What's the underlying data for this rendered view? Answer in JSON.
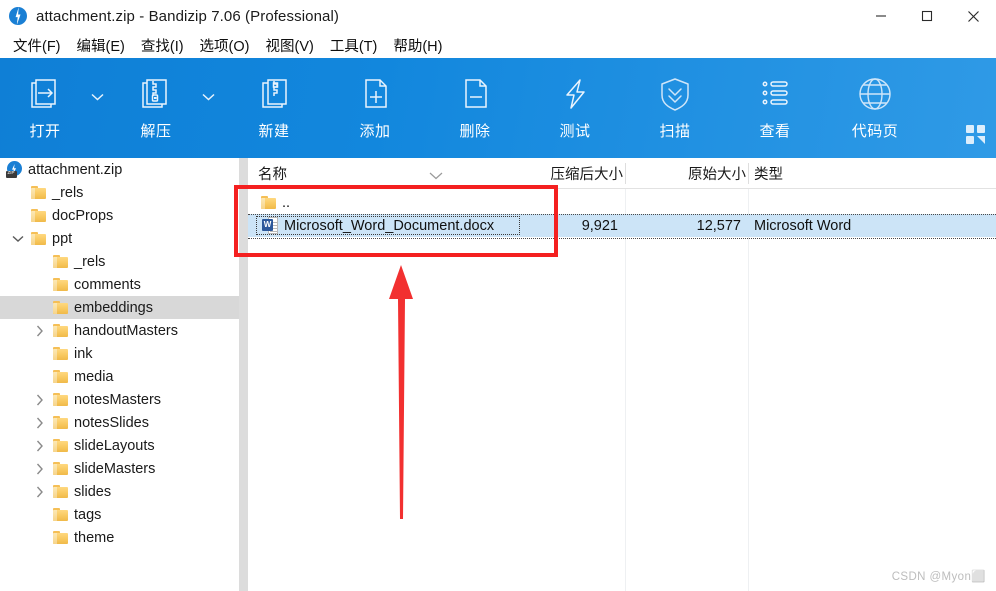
{
  "window": {
    "title": "attachment.zip - Bandizip 7.06 (Professional)",
    "app_icon": "bandizip-icon",
    "minimize_label": "─",
    "maximize_label": "□",
    "close_label": "✕"
  },
  "menubar": {
    "items": [
      {
        "label": "文件(F)",
        "name": "menu-file"
      },
      {
        "label": "编辑(E)",
        "name": "menu-edit"
      },
      {
        "label": "查找(I)",
        "name": "menu-find"
      },
      {
        "label": "选项(O)",
        "name": "menu-options"
      },
      {
        "label": "视图(V)",
        "name": "menu-view"
      },
      {
        "label": "工具(T)",
        "name": "menu-tools"
      },
      {
        "label": "帮助(H)",
        "name": "menu-help"
      }
    ]
  },
  "toolbar": {
    "background_color": "#1287dd",
    "buttons": [
      {
        "label": "打开",
        "icon": "open-archive-icon",
        "name": "toolbar-open",
        "has_dropdown": true
      },
      {
        "label": "解压",
        "icon": "extract-icon",
        "name": "toolbar-extract",
        "has_dropdown": true
      },
      {
        "label": "新建",
        "icon": "new-archive-icon",
        "name": "toolbar-new",
        "has_dropdown": false
      },
      {
        "label": "添加",
        "icon": "add-file-icon",
        "name": "toolbar-add",
        "has_dropdown": false
      },
      {
        "label": "删除",
        "icon": "delete-file-icon",
        "name": "toolbar-delete",
        "has_dropdown": false
      },
      {
        "label": "测试",
        "icon": "test-lightning-icon",
        "name": "toolbar-test",
        "has_dropdown": false
      },
      {
        "label": "扫描",
        "icon": "scan-shield-icon",
        "name": "toolbar-scan",
        "has_dropdown": false
      },
      {
        "label": "查看",
        "icon": "view-list-icon",
        "name": "toolbar-view",
        "has_dropdown": false
      },
      {
        "label": "代码页",
        "icon": "codepage-globe-icon",
        "name": "toolbar-codepage",
        "has_dropdown": false
      }
    ],
    "corner_icon": "layout-grid-icon"
  },
  "tree": {
    "root": {
      "label": "attachment.zip",
      "icon": "zip-file-icon",
      "depth": 0,
      "twisty": "none",
      "selected": false
    },
    "items": [
      {
        "label": "_rels",
        "depth": 1,
        "twisty": "none",
        "selected": false
      },
      {
        "label": "docProps",
        "depth": 1,
        "twisty": "none",
        "selected": false
      },
      {
        "label": "ppt",
        "depth": 1,
        "twisty": "expanded",
        "selected": false
      },
      {
        "label": "_rels",
        "depth": 2,
        "twisty": "none",
        "selected": false
      },
      {
        "label": "comments",
        "depth": 2,
        "twisty": "none",
        "selected": false
      },
      {
        "label": "embeddings",
        "depth": 2,
        "twisty": "none",
        "selected": true
      },
      {
        "label": "handoutMasters",
        "depth": 2,
        "twisty": "collapsed",
        "selected": false
      },
      {
        "label": "ink",
        "depth": 2,
        "twisty": "none",
        "selected": false
      },
      {
        "label": "media",
        "depth": 2,
        "twisty": "none",
        "selected": false
      },
      {
        "label": "notesMasters",
        "depth": 2,
        "twisty": "collapsed",
        "selected": false
      },
      {
        "label": "notesSlides",
        "depth": 2,
        "twisty": "collapsed",
        "selected": false
      },
      {
        "label": "slideLayouts",
        "depth": 2,
        "twisty": "collapsed",
        "selected": false
      },
      {
        "label": "slideMasters",
        "depth": 2,
        "twisty": "collapsed",
        "selected": false
      },
      {
        "label": "slides",
        "depth": 2,
        "twisty": "collapsed",
        "selected": false
      },
      {
        "label": "tags",
        "depth": 2,
        "twisty": "none",
        "selected": false
      },
      {
        "label": "theme",
        "depth": 2,
        "twisty": "none",
        "selected": false
      }
    ]
  },
  "filelist": {
    "columns": [
      {
        "label": "名称",
        "name": "column-name",
        "align": "left"
      },
      {
        "label": "压缩后大小",
        "name": "column-packed-size",
        "align": "right"
      },
      {
        "label": "原始大小",
        "name": "column-original-size",
        "align": "right"
      },
      {
        "label": "类型",
        "name": "column-type",
        "align": "left"
      }
    ],
    "sort_indicator": "chevron-down-icon",
    "rows": [
      {
        "name": "..",
        "icon": "folder-icon",
        "packed_size": "",
        "original_size": "",
        "type": "",
        "selected": false
      },
      {
        "name": "Microsoft_Word_Document.docx",
        "icon": "word-doc-icon",
        "packed_size": "9,921",
        "original_size": "12,577",
        "type": "Microsoft Word",
        "selected": true
      }
    ]
  },
  "annotations": {
    "highlight_box_color": "#f42020",
    "arrow_color": "#f42020"
  },
  "watermark": {
    "text": "CSDN @Myon⬜"
  }
}
